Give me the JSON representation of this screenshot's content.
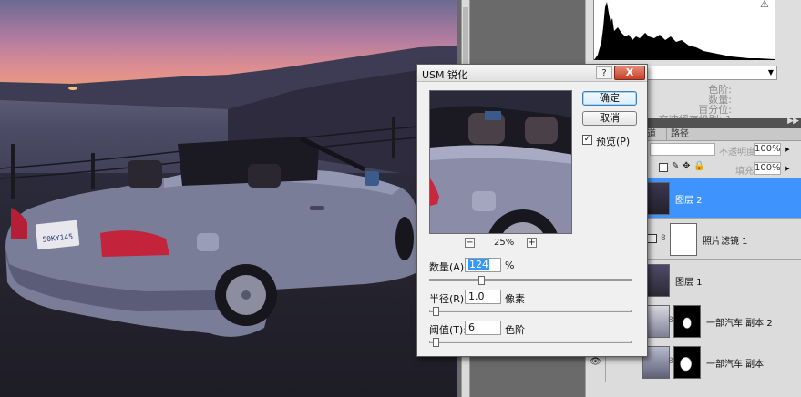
{
  "photo": {
    "plate_text": "50KY145",
    "scene": "car-photo"
  },
  "histogram_panel": {
    "warning_icon": "warning-triangle-icon",
    "stats": [
      {
        "label": "色阶:"
      },
      {
        "label": "数量:"
      },
      {
        "label": "百分位:"
      },
      {
        "label": "高速缓存级别: 1"
      }
    ]
  },
  "layers_panel": {
    "tabs": [
      "道",
      "路径"
    ],
    "opacity_label": "不透明度:",
    "opacity_value": "100%",
    "fill_label": "填充:",
    "fill_value": "100%",
    "lock_icons": [
      "lock-transparent-icon",
      "lock-brush-icon",
      "lock-move-icon",
      "lock-all-icon"
    ],
    "layers": [
      {
        "name": "图层 2",
        "selected": true
      },
      {
        "name": "照片滤镜 1",
        "selected": false
      },
      {
        "name": "图层 1",
        "selected": false
      },
      {
        "name": "一部汽车 副本 2",
        "selected": false
      },
      {
        "name": "一部汽车 副本",
        "selected": false
      }
    ]
  },
  "dialog": {
    "title": "USM 锐化",
    "help_label": "?",
    "close_label": "X",
    "ok_label": "确定",
    "cancel_label": "取消",
    "preview_label": "预览(P)",
    "preview_checked": true,
    "zoom_out_label": "−",
    "zoom_in_label": "+",
    "zoom_value": "25%",
    "fields": [
      {
        "label": "数量(A):",
        "value": "124",
        "unit": "%",
        "slider_fraction": 0.25
      },
      {
        "label": "半径(R):",
        "value": "1.0",
        "unit": "像素",
        "slider_fraction": 0.02
      },
      {
        "label": "阈值(T):",
        "value": "6",
        "unit": "色阶",
        "slider_fraction": 0.02
      }
    ]
  },
  "colors": {
    "selected_layer": "#3e94fc",
    "close_button": "#c6402a",
    "default_button_border": "#3c7fb1",
    "text_selection": "#3399ff"
  }
}
